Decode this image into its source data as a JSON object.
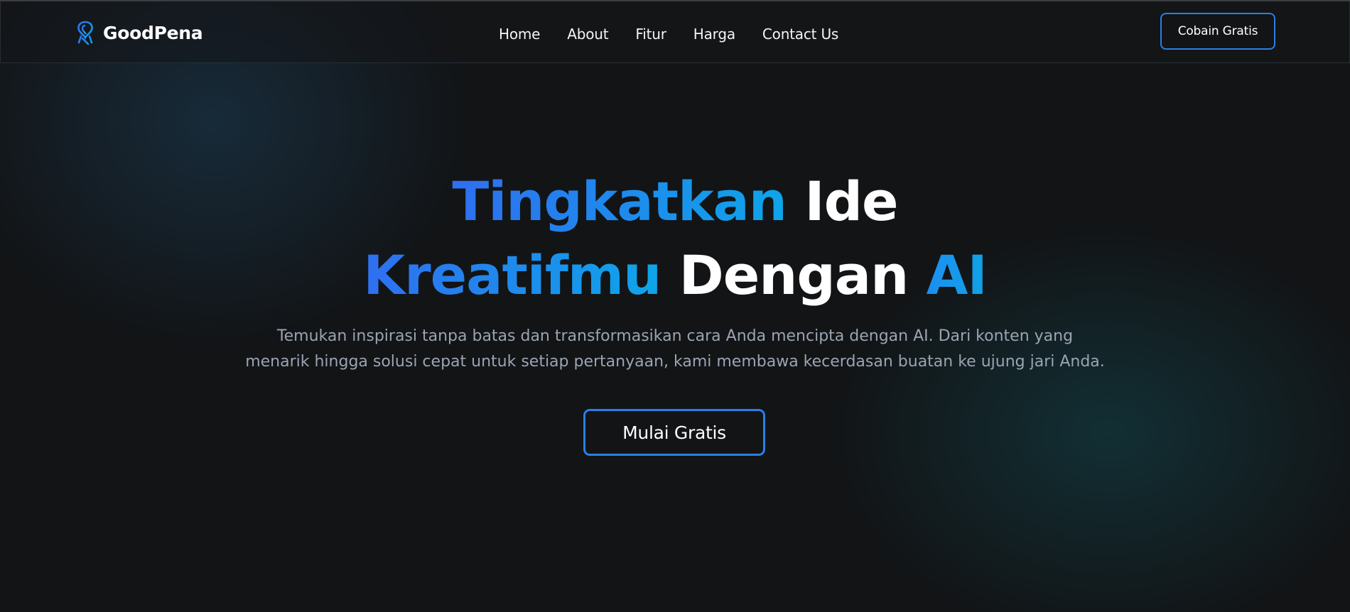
{
  "nav": {
    "brand_name": "GoodPena",
    "brand_icon": "pen-logo-icon",
    "links": [
      {
        "label": "Home"
      },
      {
        "label": "About"
      },
      {
        "label": "Fitur"
      },
      {
        "label": "Harga"
      },
      {
        "label": "Contact Us"
      }
    ],
    "cta_label": "Cobain Gratis"
  },
  "hero": {
    "title_parts": {
      "w1": "Tingkatkan",
      "w2": "Ide",
      "w3": "Kreatifmu",
      "w4": "Dengan",
      "w5": "AI"
    },
    "subtitle_line1": "Temukan inspirasi tanpa batas dan transformasikan cara Anda mencipta dengan AI. Dari konten yang",
    "subtitle_line2": "menarik hingga solusi cepat untuk setiap pertanyaan, kami membawa kecerdasan buatan ke ujung jari Anda.",
    "cta_label": "Mulai Gratis"
  },
  "colors": {
    "background": "#121416",
    "accent_blue": "#2f6ff0",
    "accent_cyan": "#0ea5e9",
    "subtitle_gray": "#9aa4b2"
  }
}
